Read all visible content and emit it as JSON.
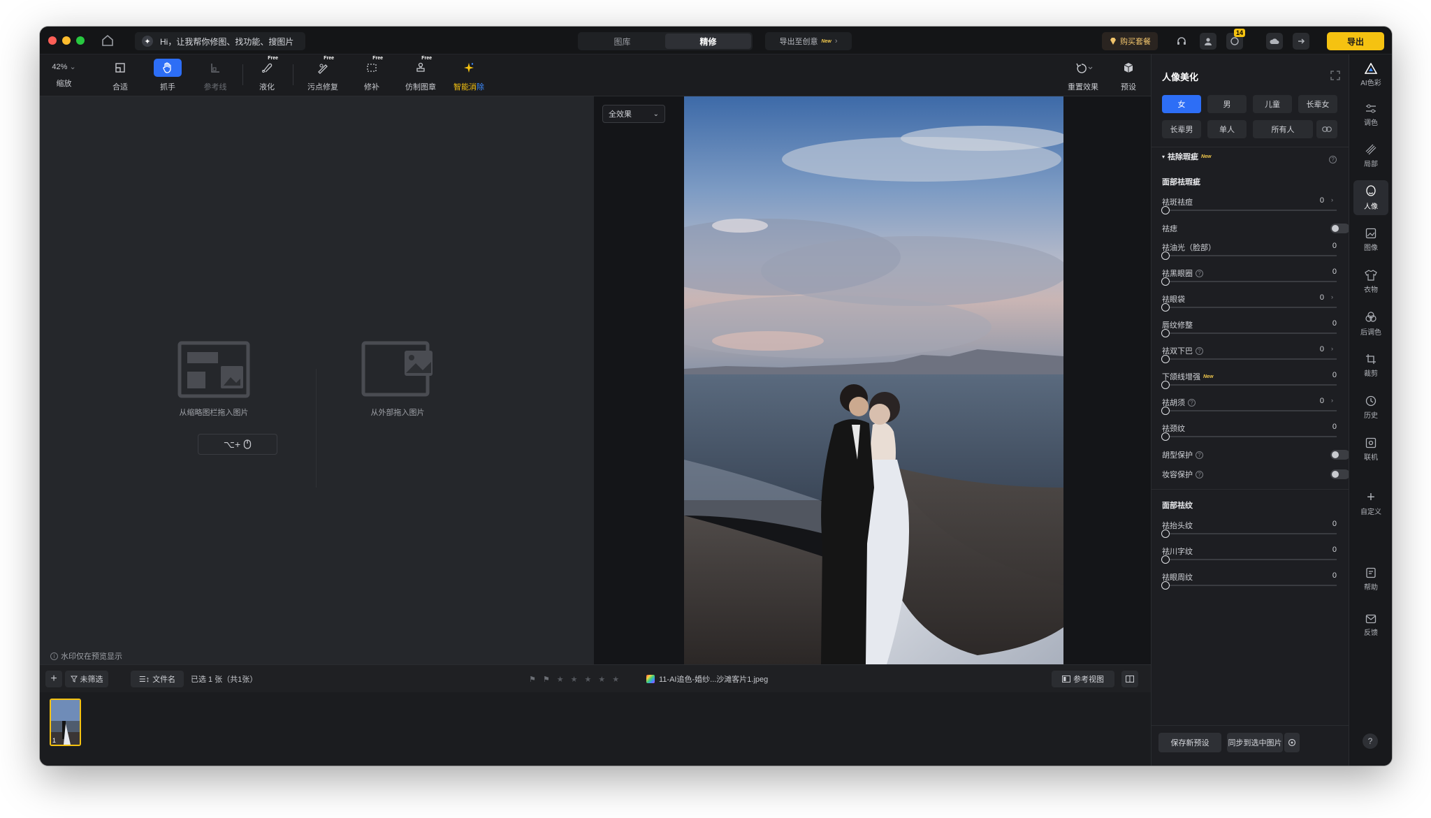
{
  "titlebar": {
    "ai_prompt": "Hi，让我帮你修图、找功能、搜图片",
    "tabs": [
      "图库",
      "精修"
    ],
    "active_tab": "精修",
    "export_creative": "导出至创意",
    "export_creative_badge": "New",
    "buy_label": "购买套餐",
    "notification_count": "14",
    "export_label": "导出"
  },
  "toolbar": {
    "zoom_value": "42%",
    "tools": [
      "缩放",
      "合适",
      "抓手",
      "参考线",
      "液化",
      "污点修复",
      "修补",
      "仿制图章"
    ],
    "free_badge": "Free",
    "ai_erase_part1": "智能消",
    "ai_erase_part2": "除",
    "reset_label": "重置效果",
    "preset_label": "预设"
  },
  "left_panel": {
    "drop_thumb_label": "从缩略图栏拖入图片",
    "drop_external_label": "从外部拖入图片",
    "shortcut_keys": "⌥+",
    "watermark_note": "水印仅在预览显示"
  },
  "center": {
    "effect_select": "全效果"
  },
  "right_panel": {
    "title": "人像美化",
    "chips_row1": [
      "女",
      "男",
      "儿童",
      "长辈女"
    ],
    "chips_row2": [
      "长辈男",
      "单人",
      "所有人"
    ],
    "blemish_section": "祛除瑕疵",
    "new_badge": "New",
    "face_blemish_header": "面部祛瑕疵",
    "rows": [
      {
        "label": "祛斑祛痘",
        "value": "0"
      },
      {
        "label": "祛痣"
      },
      {
        "label": "祛油光（脸部）",
        "value": "0"
      },
      {
        "label": "祛黑眼圈",
        "value": "0"
      },
      {
        "label": "祛眼袋",
        "value": "0"
      },
      {
        "label": "唇纹修整",
        "value": "0"
      },
      {
        "label": "祛双下巴",
        "value": "0"
      },
      {
        "label": "下颌线增强",
        "value": "0"
      },
      {
        "label": "祛胡须",
        "value": "0"
      },
      {
        "label": "祛颈纹",
        "value": "0"
      },
      {
        "label": "胡型保护"
      },
      {
        "label": "妆容保护"
      }
    ],
    "wrinkle_header": "面部祛纹",
    "wrinkle_rows": [
      {
        "label": "祛抬头纹",
        "value": "0"
      },
      {
        "label": "祛川字纹",
        "value": "0"
      },
      {
        "label": "祛眼周纹",
        "value": "0"
      }
    ],
    "save_preset": "保存新预设",
    "sync_selected": "同步到选中图片"
  },
  "sidebar": {
    "items": [
      "AI色彩",
      "调色",
      "局部",
      "人像",
      "图像",
      "衣物",
      "后调色",
      "裁剪",
      "历史",
      "联机",
      "自定义",
      "帮助",
      "反馈"
    ],
    "active": "人像",
    "help_glyph": "?"
  },
  "bottom_bar": {
    "filter_label": "未筛选",
    "sort_label": "文件名",
    "selection_info": "已选 1 张（共1张）",
    "filename": "11-AI追色-婚纱...沙滩客片1.jpeg",
    "reference_view": "参考视图"
  },
  "filmstrip": {
    "thumb_number": "1"
  },
  "colors": {
    "accent_blue": "#2d6ef6",
    "accent_yellow": "#f5c211",
    "bg_dark": "#1b1c1f"
  }
}
